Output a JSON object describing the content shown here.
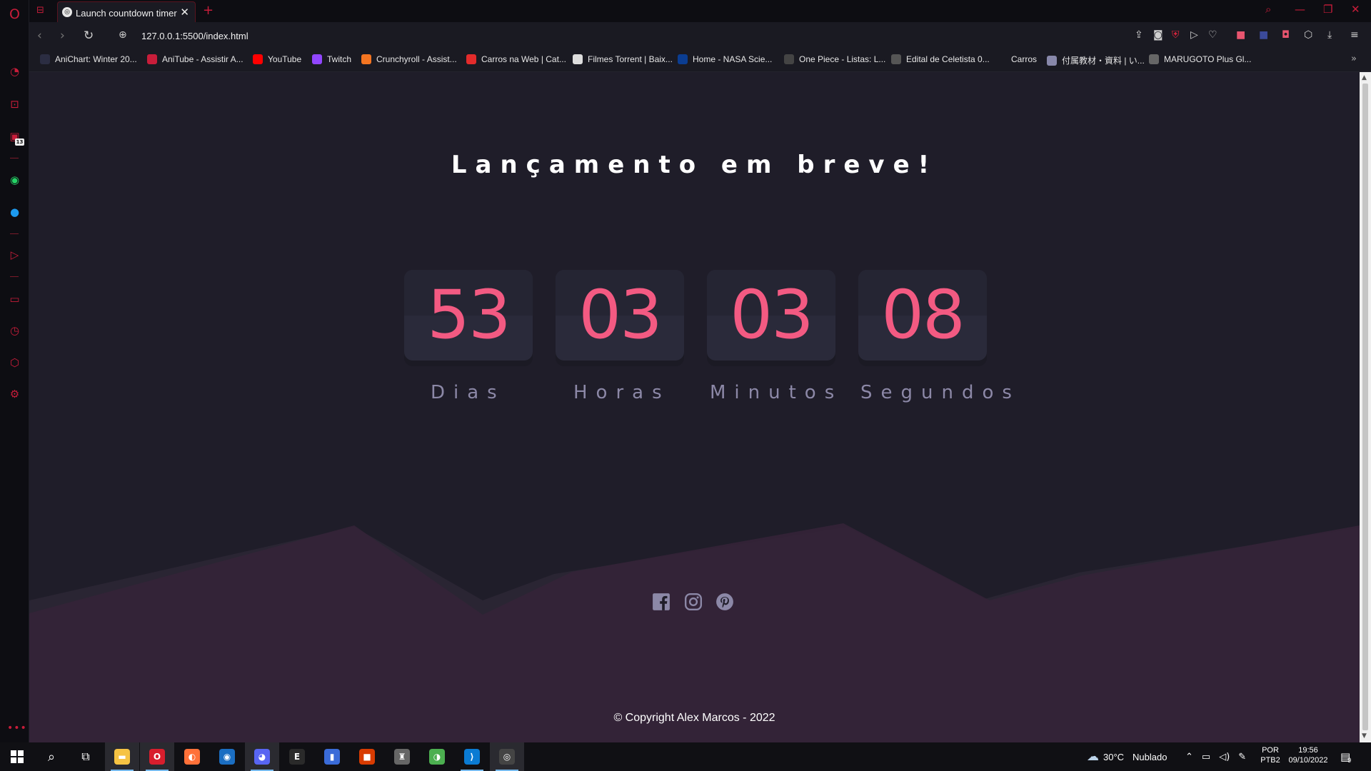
{
  "browser": {
    "tab_title": "Launch countdown timer",
    "url": "127.0.0.1:5500/index.html",
    "sidebar_badge": "13",
    "bookmarks": [
      {
        "label": "AniChart: Winter 20...",
        "icon": "anichart-icon",
        "color": "#2b2d42"
      },
      {
        "label": "AniTube - Assistir A...",
        "icon": "anitube-icon",
        "color": "#c81d3a"
      },
      {
        "label": "YouTube",
        "icon": "youtube-icon",
        "color": "#ff0000"
      },
      {
        "label": "Twitch",
        "icon": "twitch-icon",
        "color": "#9146ff"
      },
      {
        "label": "Crunchyroll - Assist...",
        "icon": "crunchyroll-icon",
        "color": "#f47521"
      },
      {
        "label": "Carros na Web | Cat...",
        "icon": "carros-na-web-icon",
        "color": "#e32b2b"
      },
      {
        "label": "Filmes Torrent | Baix...",
        "icon": "file-icon",
        "color": "#dddddd"
      },
      {
        "label": "Home - NASA Scie...",
        "icon": "nasa-icon",
        "color": "#0b3d91"
      },
      {
        "label": "One Piece - Listas: L...",
        "icon": "one-piece-icon",
        "color": "#444444"
      },
      {
        "label": "Edital de Celetista 0...",
        "icon": "globe-icon",
        "color": "#555555"
      },
      {
        "label": "Carros",
        "icon": "folder-icon",
        "color": "#1a1a22"
      },
      {
        "label": "付属教材・資料 | い...",
        "icon": "irodori-icon",
        "color": "#8888aa"
      },
      {
        "label": "MARUGOTO Plus Gl...",
        "icon": "marugoto-icon",
        "color": "#666666"
      }
    ]
  },
  "page": {
    "headline": "Lançamento em breve!",
    "countdown": [
      {
        "value": "53",
        "label": "Dias"
      },
      {
        "value": "03",
        "label": "Horas"
      },
      {
        "value": "03",
        "label": "Minutos"
      },
      {
        "value": "08",
        "label": "Segundos"
      }
    ],
    "social": [
      "facebook-icon",
      "instagram-icon",
      "pinterest-icon"
    ],
    "copyright": "© Copyright Alex Marcos - 2022",
    "colors": {
      "accent": "#f35a82",
      "label": "#8c88a7",
      "background": "#1f1d29",
      "hills": "#342437"
    }
  },
  "taskbar": {
    "weather_temp": "30°C",
    "weather_desc": "Nublado",
    "lang_top": "POR",
    "lang_bottom": "PTB2",
    "time": "19:56",
    "date": "09/10/2022",
    "notifications": "9",
    "apps": [
      "file-explorer-icon",
      "opera-icon",
      "firefox-icon",
      "steam-icon",
      "discord-icon",
      "epic-games-icon",
      "app-icon",
      "office-icon",
      "app2-icon",
      "app3-icon",
      "vscode-icon",
      "obs-icon"
    ]
  }
}
